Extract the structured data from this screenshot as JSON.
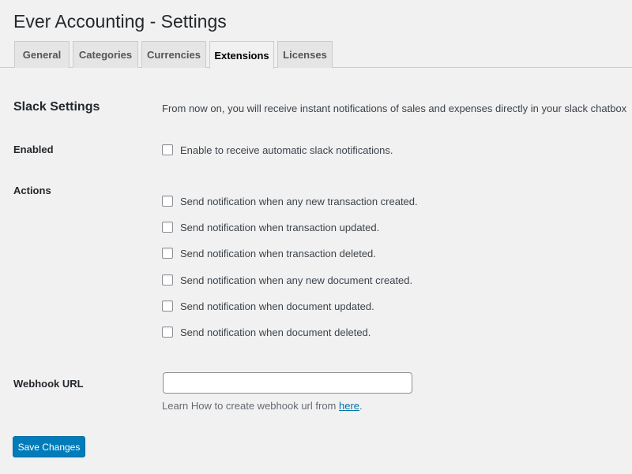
{
  "page": {
    "title": "Ever Accounting - Settings"
  },
  "tabs": [
    {
      "label": "General",
      "active": false
    },
    {
      "label": "Categories",
      "active": false
    },
    {
      "label": "Currencies",
      "active": false
    },
    {
      "label": "Extensions",
      "active": true
    },
    {
      "label": "Licenses",
      "active": false
    }
  ],
  "section": {
    "title": "Slack Settings",
    "description": "From now on, you will receive instant notifications of sales and expenses directly in your slack chatbox"
  },
  "enabled": {
    "label": "Enabled",
    "checkbox_label": "Enable to receive automatic slack notifications.",
    "checked": false
  },
  "actions": {
    "label": "Actions",
    "items": [
      {
        "label": "Send notification when any new transaction created.",
        "checked": false
      },
      {
        "label": "Send notification when transaction updated.",
        "checked": false
      },
      {
        "label": "Send notification when transaction deleted.",
        "checked": false
      },
      {
        "label": "Send notification when any new document created.",
        "checked": false
      },
      {
        "label": "Send notification when document updated.",
        "checked": false
      },
      {
        "label": "Send notification when document deleted.",
        "checked": false
      }
    ]
  },
  "webhook": {
    "label": "Webhook URL",
    "value": "",
    "help_prefix": "Learn How to create webhook url from ",
    "help_link": "here",
    "help_suffix": "."
  },
  "footer": {
    "save_label": "Save Changes"
  },
  "colors": {
    "accent": "#007cba",
    "link": "#0073aa"
  }
}
